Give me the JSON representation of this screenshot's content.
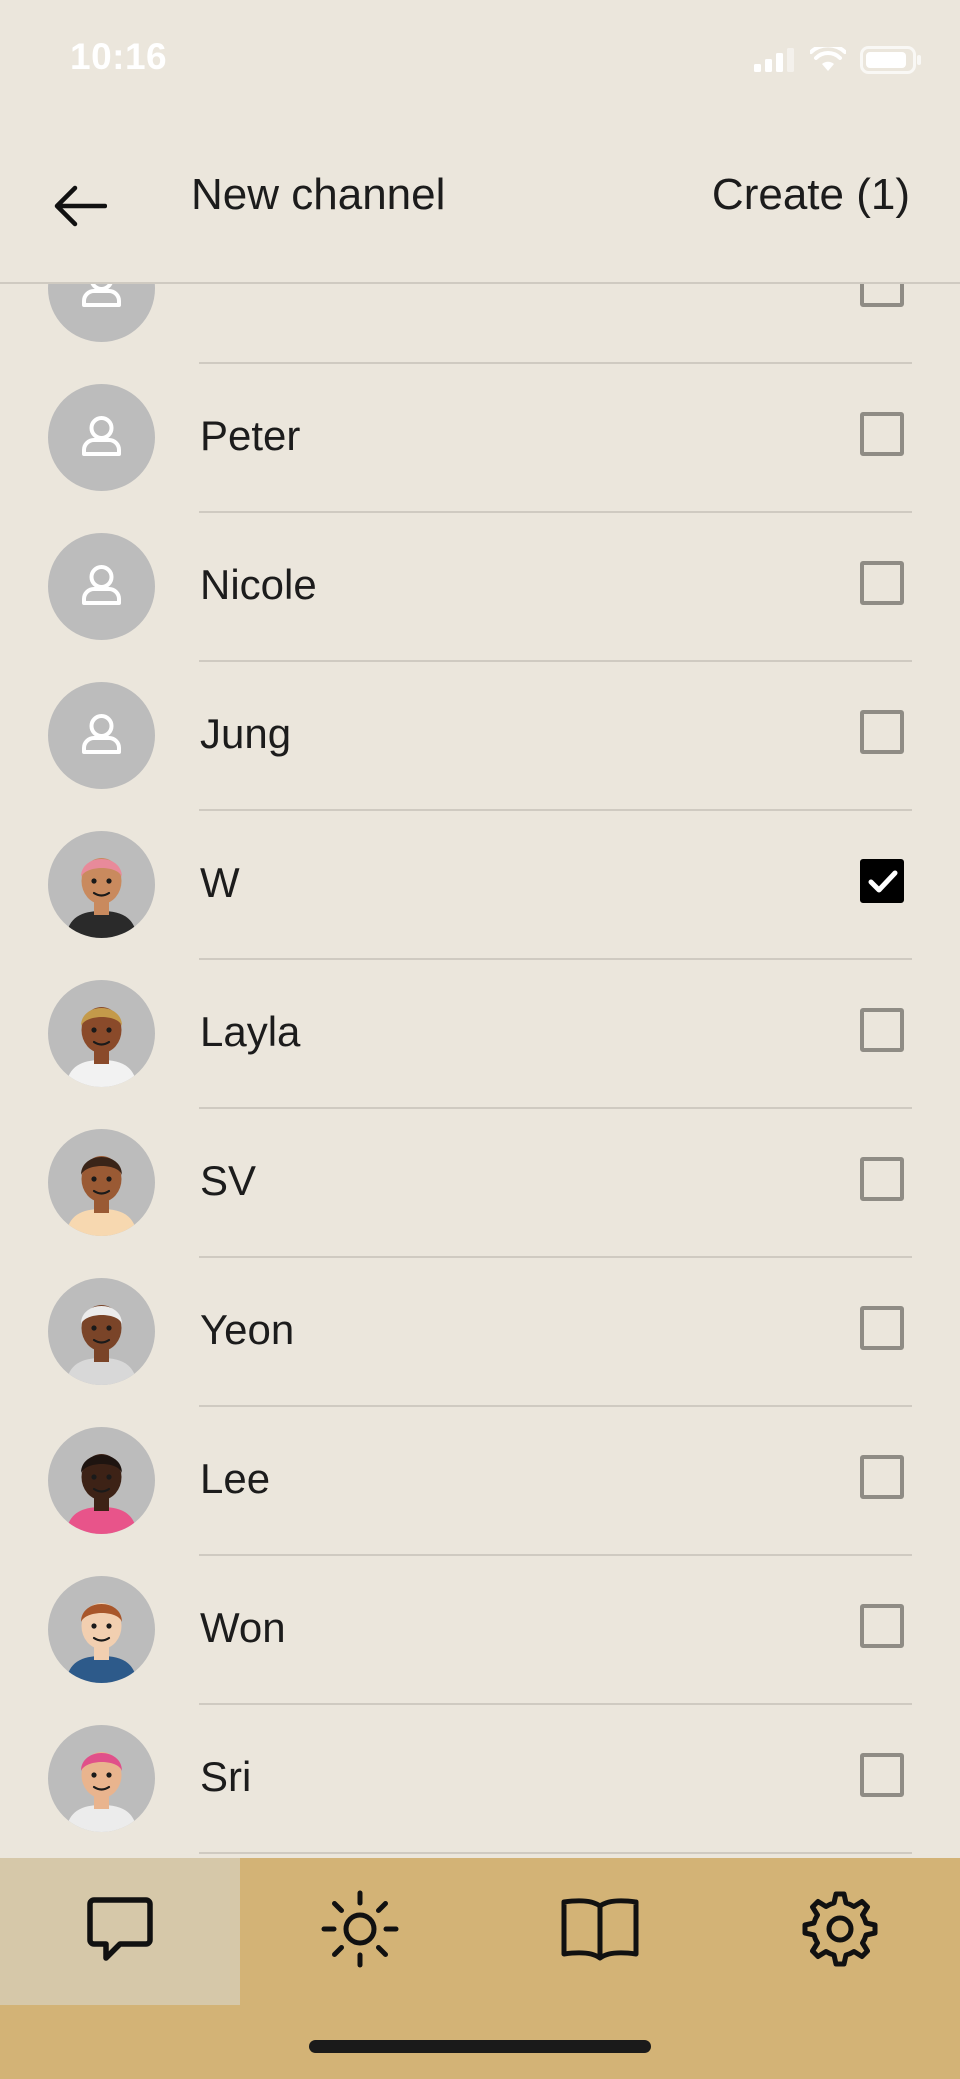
{
  "status": {
    "time": "10:16"
  },
  "header": {
    "title": "New channel",
    "create_label": "Create (1)"
  },
  "contacts": [
    {
      "name": "",
      "avatar": "placeholder-avatar",
      "checked": false
    },
    {
      "name": "Peter",
      "avatar": "placeholder-avatar",
      "checked": false
    },
    {
      "name": "Nicole",
      "avatar": "placeholder-avatar",
      "checked": false
    },
    {
      "name": "Jung",
      "avatar": "placeholder-avatar",
      "checked": false
    },
    {
      "name": "W",
      "avatar": "illustrated-avatar",
      "checked": true
    },
    {
      "name": "Layla",
      "avatar": "illustrated-avatar",
      "checked": false
    },
    {
      "name": "SV",
      "avatar": "illustrated-avatar",
      "checked": false
    },
    {
      "name": "Yeon",
      "avatar": "illustrated-avatar",
      "checked": false
    },
    {
      "name": "Lee",
      "avatar": "illustrated-avatar",
      "checked": false
    },
    {
      "name": "Won",
      "avatar": "illustrated-avatar",
      "checked": false
    },
    {
      "name": "Sri",
      "avatar": "illustrated-avatar",
      "checked": false
    },
    {
      "name": "",
      "avatar": "placeholder-avatar",
      "checked": false
    }
  ],
  "tabs": [
    {
      "icon": "chat-icon",
      "active": true
    },
    {
      "icon": "sun-icon",
      "active": false
    },
    {
      "icon": "book-icon",
      "active": false
    },
    {
      "icon": "gear-icon",
      "active": false
    }
  ],
  "colors": {
    "background": "#ebe6dc",
    "tabbar": "#d3b376",
    "tab_active": "#d6c8a9",
    "separator": "#cfcac1",
    "avatar_placeholder": "#bcbcbc"
  }
}
